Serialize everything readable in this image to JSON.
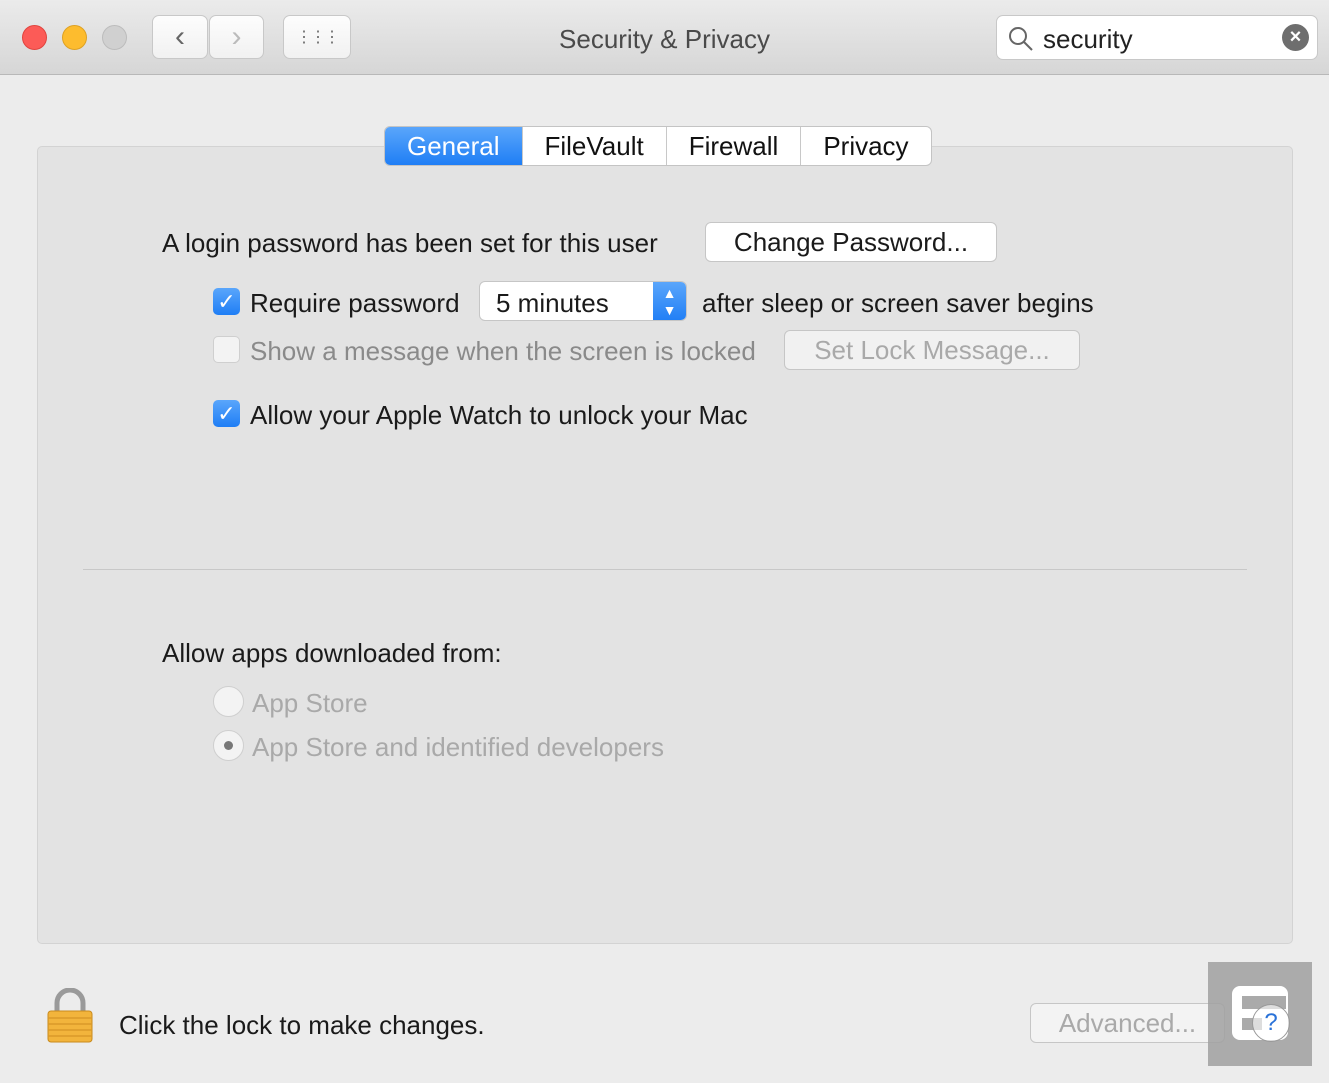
{
  "window": {
    "title": "Security & Privacy"
  },
  "toolbar": {
    "back": "‹",
    "forward": "›",
    "grid": "⋮⋮⋮"
  },
  "search": {
    "value": "security",
    "clear": "×"
  },
  "tabs": [
    {
      "label": "General",
      "active": true
    },
    {
      "label": "FileVault"
    },
    {
      "label": "Firewall"
    },
    {
      "label": "Privacy"
    }
  ],
  "general": {
    "login_text": "A login password has been set for this user",
    "change_password": "Change Password...",
    "require_password": {
      "label": "Require password",
      "checked": true,
      "value": "5 minutes",
      "suffix": "after sleep or screen saver begins"
    },
    "show_message": {
      "label": "Show a message when the screen is locked",
      "checked": false,
      "button": "Set Lock Message..."
    },
    "apple_watch": {
      "label": "Allow your Apple Watch to unlock your Mac",
      "checked": true
    },
    "allow_apps_label": "Allow apps downloaded from:",
    "options": [
      {
        "label": "App Store",
        "selected": false
      },
      {
        "label": "App Store and identified developers",
        "selected": true
      }
    ]
  },
  "footer": {
    "lock_text": "Click the lock to make changes.",
    "advanced": "Advanced...",
    "help": "?"
  }
}
